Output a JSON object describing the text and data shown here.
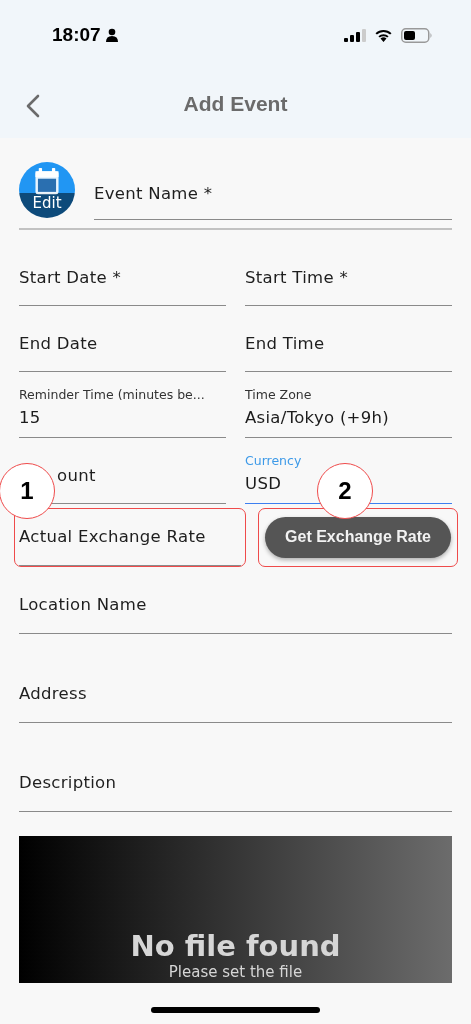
{
  "status_bar": {
    "time": "18:07"
  },
  "app_bar": {
    "title": "Add Event"
  },
  "avatar": {
    "label": "Edit"
  },
  "event_name": {
    "label": "Event Name *"
  },
  "rows": [
    [
      {
        "label": "Start Date *"
      },
      {
        "label": "Start Time *"
      }
    ],
    [
      {
        "label": "End Date"
      },
      {
        "label": "End Time"
      }
    ],
    [
      {
        "label": "Reminder Time (minutes be...",
        "value": "15",
        "focused": false
      },
      {
        "label": "Time Zone",
        "value": "Asia/Tokyo (+9h)",
        "focused": false
      }
    ],
    [
      {
        "label": "ount",
        "partially_hidden": true
      },
      {
        "label": "Currency",
        "value": "USD",
        "focused": true
      }
    ]
  ],
  "exchange": {
    "rate_field": {
      "placeholder": "Actual Exchange Rate"
    },
    "button": "Get Exchange Rate"
  },
  "annotations": [
    {
      "number": "1"
    },
    {
      "number": "2"
    }
  ],
  "fields": [
    {
      "label": "Location Name"
    },
    {
      "label": "Address"
    },
    {
      "label": "Description"
    }
  ],
  "file_panel": {
    "title": "No file found",
    "subtitle": "Please set the file"
  }
}
